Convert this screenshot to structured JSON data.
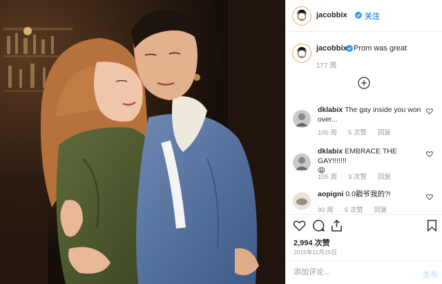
{
  "post": {
    "author": "jacobbix",
    "follow_label": "关注",
    "caption_text": "Prom was great",
    "caption_time": "177 周",
    "likes": "2,994 次赞",
    "date": "2015年11月25日",
    "add_comment_placeholder": "添加评论...",
    "post_label": "发布"
  },
  "comments": [
    {
      "user": "dklabix",
      "text": "The gay inside you won over...",
      "time": "105 周",
      "likes": "5 次赞",
      "reply": "回复"
    },
    {
      "user": "dklabix",
      "text": "EMBRACE THE GAY!!!!!!!",
      "emoji": "😩",
      "time": "105 周",
      "likes": "3 次赞",
      "reply": "回复"
    },
    {
      "user": "aopigni",
      "text": "0.0戳爷我的?!",
      "time": "90 周",
      "likes": "5 次赞",
      "reply": "回复"
    }
  ],
  "icons": {
    "verified": "verified-badge-icon",
    "load_more": "plus-circle-icon",
    "like": "heart-icon",
    "comment": "comment-bubble-icon",
    "share": "share-upload-icon",
    "save": "bookmark-icon"
  },
  "colors": {
    "accent": "#3897f0",
    "muted": "#999999",
    "border": "#efefef"
  }
}
